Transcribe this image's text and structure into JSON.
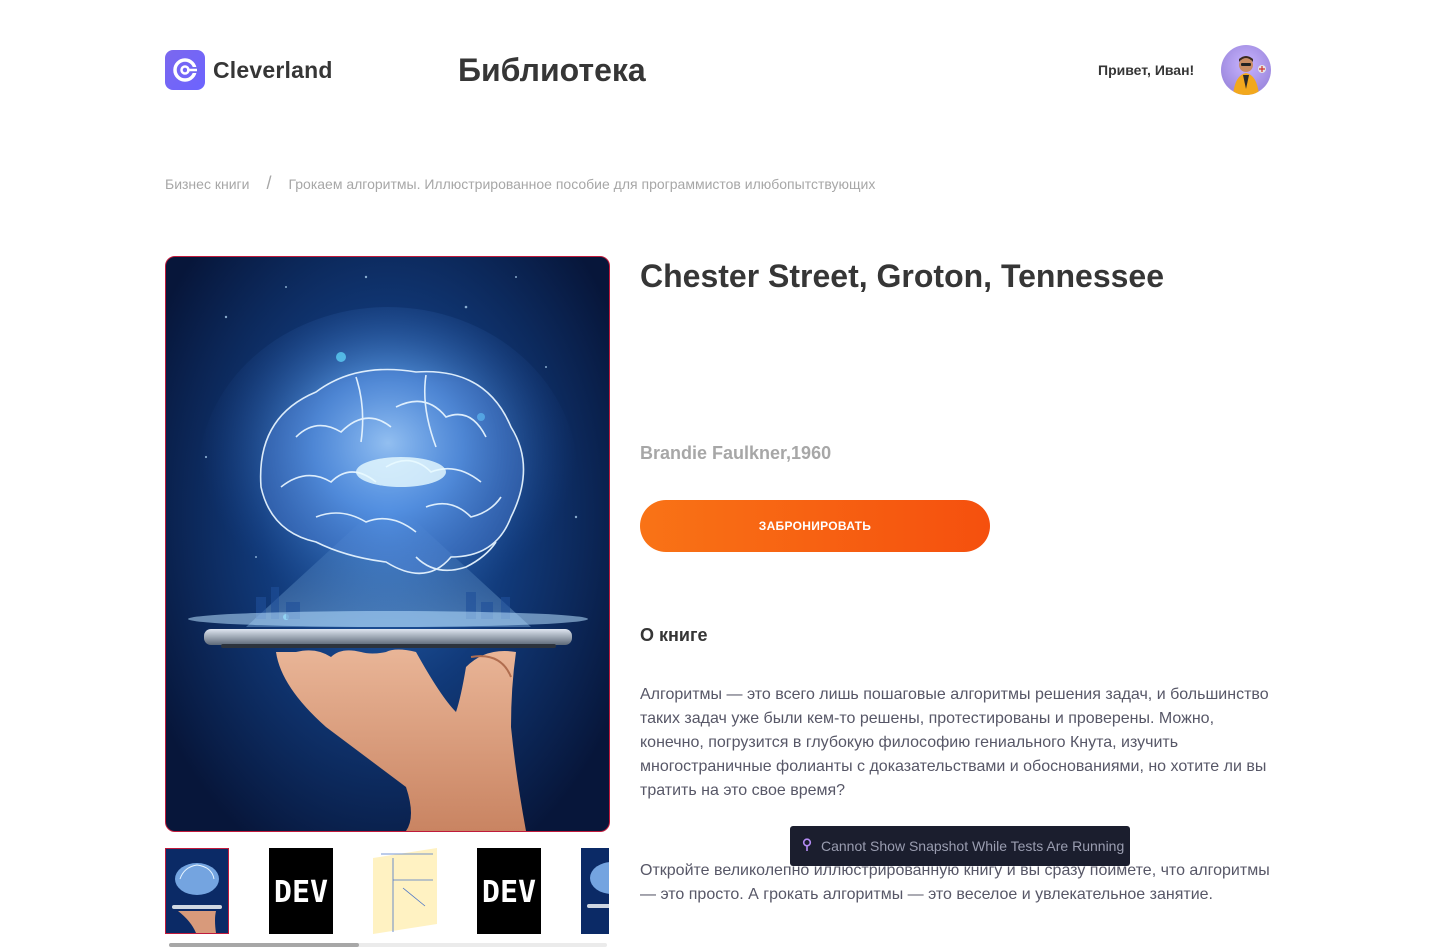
{
  "header": {
    "brand": "Cleverland",
    "page_title": "Библиотека",
    "greeting": "Привет, Иван!"
  },
  "breadcrumb": {
    "category": "Бизнес книги",
    "separator": "/",
    "current": "Грокаем алгоритмы. Иллюстрированное пособие для программистов илюбопытствующих"
  },
  "book": {
    "title": "Chester Street, Groton, Tennessee",
    "author_year": "Brandie Faulkner,1960",
    "book_button": "ЗАБРОНИРОВАТЬ",
    "about_heading": "О книге",
    "description": [
      "Алгоритмы — это всего лишь пошаговые алгоритмы решения задач, и большинство таких задач уже были кем-то решены, протестированы и проверены. Можно, конечно, погрузится в глубокую философию гениального Кнута, изучить многостраничные фолианты с доказательствами и обоснованиями, но хотите ли вы тратить на это свое время?",
      "Откройте великолепно иллюстрированную книгу и вы сразу поймете, что алгоритмы — это просто. А грокать алгоритмы — это веселое и увлекательное занятие."
    ]
  },
  "thumbnails": [
    {
      "kind": "brain",
      "selected": true
    },
    {
      "kind": "dev",
      "text": "DEV"
    },
    {
      "kind": "diagram"
    },
    {
      "kind": "dev",
      "text": "DEV"
    },
    {
      "kind": "brain"
    }
  ],
  "tooltip": {
    "text": "Cannot Show Snapshot While Tests Are Running",
    "icon": "pin-icon"
  },
  "colors": {
    "accent": "#f97316",
    "selected_border": "#c01a3b",
    "text_dark": "#363636",
    "text_muted": "#a7a7a7"
  }
}
